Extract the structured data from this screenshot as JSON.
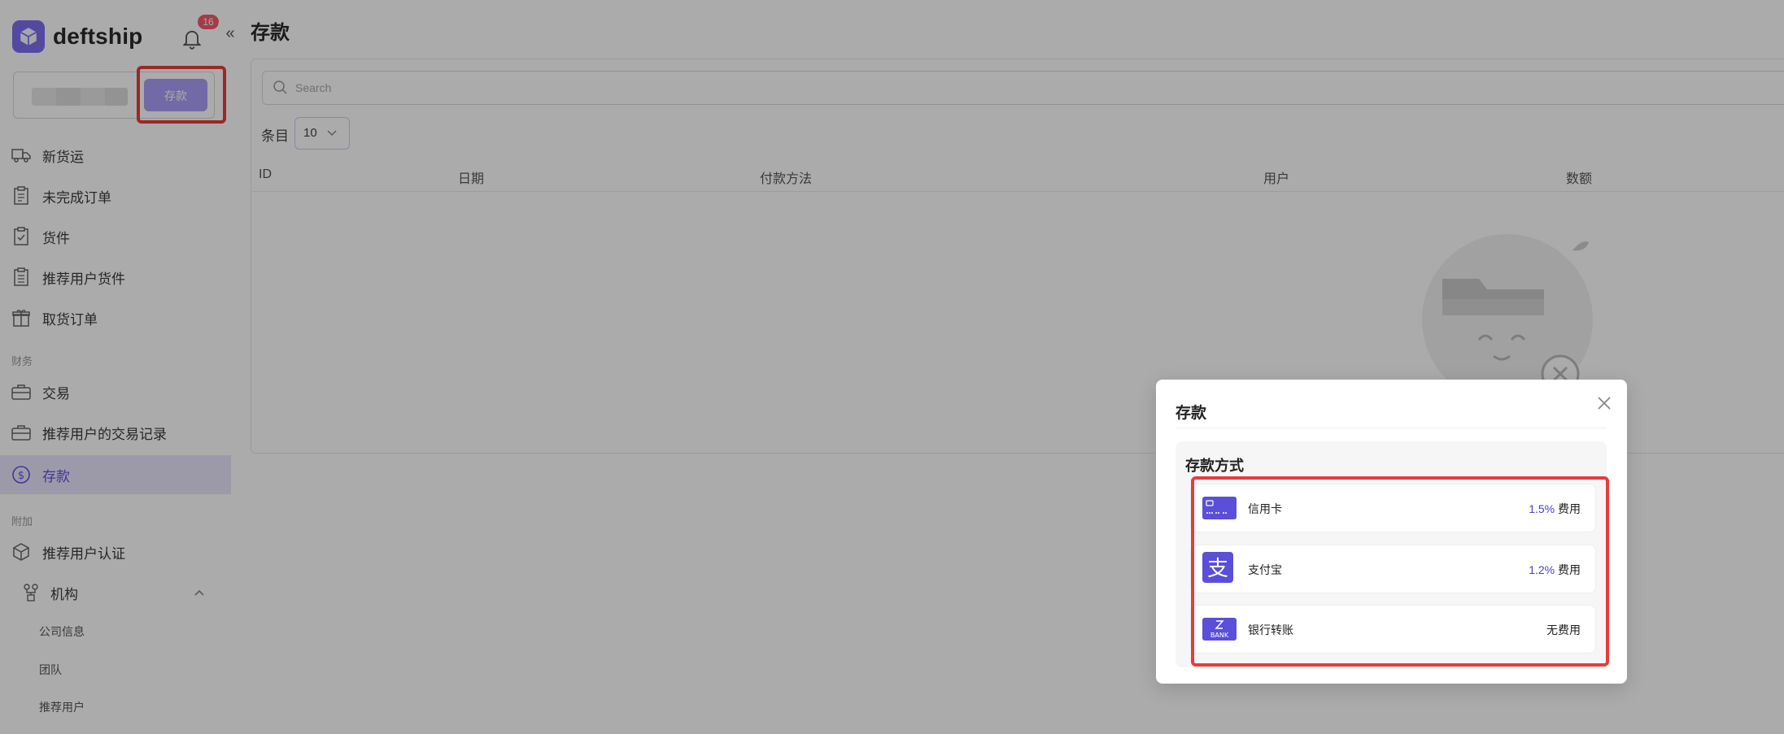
{
  "app": {
    "logo_text": "deftship",
    "notification_count": "16"
  },
  "sidebar": {
    "deposit_button": "存款",
    "items": [
      {
        "label": "新货运",
        "icon": "truck-icon"
      },
      {
        "label": "未完成订单",
        "icon": "clipboard-icon"
      },
      {
        "label": "货件",
        "icon": "clipboard-check-icon"
      },
      {
        "label": "推荐用户货件",
        "icon": "clipboard-list-icon"
      },
      {
        "label": "取货订单",
        "icon": "gift-box-icon"
      }
    ],
    "section_finance": "财务",
    "finance_items": [
      {
        "label": "交易",
        "icon": "briefcase-icon"
      },
      {
        "label": "推荐用户的交易记录",
        "icon": "briefcase-icon"
      },
      {
        "label": "存款",
        "icon": "dollar-circle-icon",
        "active": true
      }
    ],
    "section_extra": "附加",
    "extra_items": [
      {
        "label": "推荐用户认证",
        "icon": "cube-icon"
      },
      {
        "label": "机构",
        "icon": "org-chart-icon"
      }
    ],
    "org_sub_items": [
      "公司信息",
      "团队",
      "推荐用户"
    ]
  },
  "main": {
    "title": "存款",
    "search_placeholder": "Search",
    "entries_label": "条目",
    "entries_value": "10",
    "columns": [
      "ID",
      "日期",
      "付款方法",
      "用户",
      "数额"
    ]
  },
  "modal": {
    "title": "存款",
    "methods_title": "存款方式",
    "methods": [
      {
        "name": "信用卡",
        "fee_pct": "1.5%",
        "fee_suffix": " 费用",
        "icon": "credit-card-icon"
      },
      {
        "name": "支付宝",
        "fee_pct": "1.2%",
        "fee_suffix": " 费用",
        "icon": "alipay-icon"
      },
      {
        "name": "银行转账",
        "fee_pct": "",
        "fee_suffix": "无费用",
        "icon": "bank-transfer-icon",
        "icon_text": "BANK"
      }
    ]
  },
  "colors": {
    "accent": "#7c6ef0",
    "highlight": "#ea3b3b",
    "badge": "#f25a6b"
  }
}
